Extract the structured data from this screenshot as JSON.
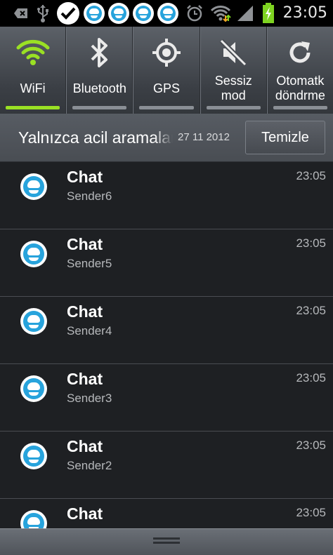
{
  "status_bar": {
    "time": "23:05",
    "icons": [
      "usb-debug-icon",
      "usb-icon",
      "check-icon",
      "chat-notification-icon",
      "chat-notification-icon",
      "chat-notification-icon",
      "chat-notification-icon",
      "alarm-icon",
      "wifi-signal-icon",
      "cell-signal-icon",
      "battery-charging-icon"
    ],
    "colors": {
      "chat": "#27a3dc",
      "battery": "#7ed321"
    }
  },
  "toggles": [
    {
      "label": "WiFi",
      "icon": "wifi-icon",
      "active": true
    },
    {
      "label": "Bluetooth",
      "icon": "bluetooth-icon",
      "active": false
    },
    {
      "label": "GPS",
      "icon": "gps-icon",
      "active": false
    },
    {
      "label": "Sessiz\nmod",
      "icon": "mute-icon",
      "active": false
    },
    {
      "label": "Otomatk\ndöndrme",
      "icon": "rotate-icon",
      "active": false
    }
  ],
  "header": {
    "carrier": "Yalnızca acil aramalar",
    "date": "27 11 2012",
    "clear_label": "Temizle"
  },
  "notifications": [
    {
      "title": "Chat",
      "sender": "Sender6",
      "time": "23:05"
    },
    {
      "title": "Chat",
      "sender": "Sender5",
      "time": "23:05"
    },
    {
      "title": "Chat",
      "sender": "Sender4",
      "time": "23:05"
    },
    {
      "title": "Chat",
      "sender": "Sender3",
      "time": "23:05"
    },
    {
      "title": "Chat",
      "sender": "Sender2",
      "time": "23:05"
    },
    {
      "title": "Chat",
      "sender": "",
      "time": "23:05"
    }
  ],
  "accent": "#9ae024"
}
